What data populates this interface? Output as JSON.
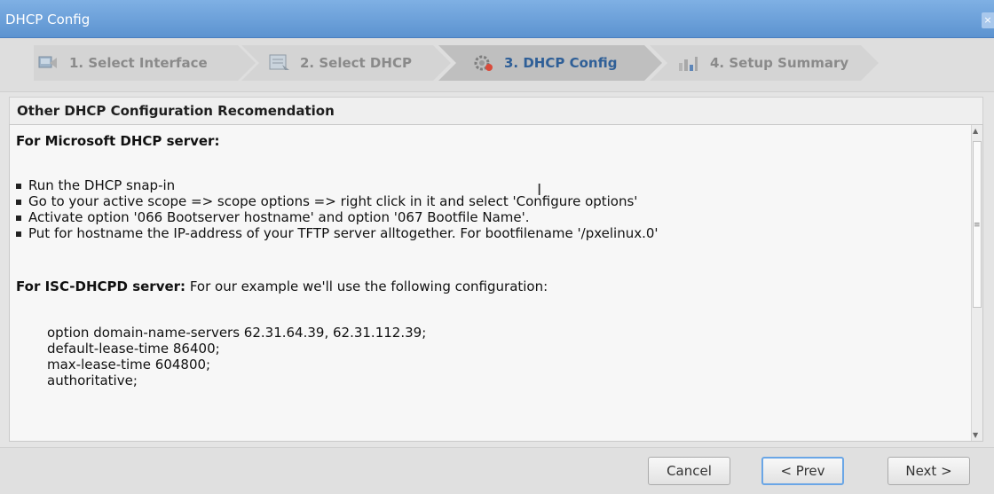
{
  "window": {
    "title": "DHCP Config",
    "close_glyph": "×"
  },
  "steps": [
    {
      "label": "1. Select Interface",
      "icon": "network-interface-icon"
    },
    {
      "label": "2. Select DHCP",
      "icon": "server-select-icon"
    },
    {
      "label": "3. DHCP Config",
      "icon": "gear-config-icon"
    },
    {
      "label": "4. Setup Summary",
      "icon": "bar-chart-icon"
    }
  ],
  "section": {
    "title": "Other DHCP Configuration Recomendation"
  },
  "content": {
    "ms_heading": "For Microsoft DHCP server:",
    "ms_bullets": [
      "Run the DHCP snap-in",
      "Go to your active scope => scope options => right click in it and select 'Configure options'",
      "Activate option '066 Bootserver hostname' and option '067 Bootfile Name'.",
      "Put for hostname the IP-address of your TFTP server alltogether. For bootfilename '/pxelinux.0'"
    ],
    "isc_heading": "For ISC-DHCPD server:",
    "isc_intro": " For our example we'll use the following configuration:",
    "isc_config": [
      "option domain-name-servers 62.31.64.39, 62.31.112.39;",
      "default-lease-time 86400;",
      "max-lease-time 604800;",
      "authoritative;"
    ]
  },
  "buttons": {
    "cancel": "Cancel",
    "prev": "< Prev",
    "next": "Next >"
  }
}
